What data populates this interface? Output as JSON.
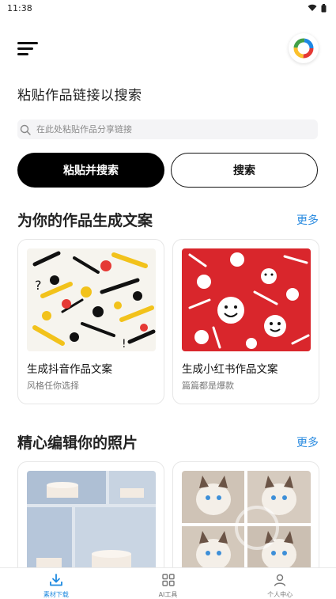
{
  "status_bar": {
    "time": "11:38"
  },
  "header": {
    "title": "粘贴作品链接以搜索"
  },
  "search": {
    "placeholder": "在此处粘贴作品分享链接"
  },
  "buttons": {
    "paste_search": "粘贴并搜索",
    "search": "搜索"
  },
  "sections": [
    {
      "title": "为你的作品生成文案",
      "more": "更多",
      "cards": [
        {
          "title": "生成抖音作品文案",
          "subtitle": "风格任你选择"
        },
        {
          "title": "生成小红书作品文案",
          "subtitle": "篇篇都是爆款"
        }
      ]
    },
    {
      "title": "精心编辑你的照片",
      "more": "更多"
    }
  ],
  "tabbar": [
    {
      "label": "素材下载",
      "icon": "download-icon",
      "active": true
    },
    {
      "label": "AI工具",
      "icon": "grid-icon",
      "active": false
    },
    {
      "label": "个人中心",
      "icon": "person-icon",
      "active": false
    }
  ],
  "colors": {
    "accent": "#2a8be0",
    "primary_button": "#000000",
    "search_bg": "#f4f4f6"
  }
}
